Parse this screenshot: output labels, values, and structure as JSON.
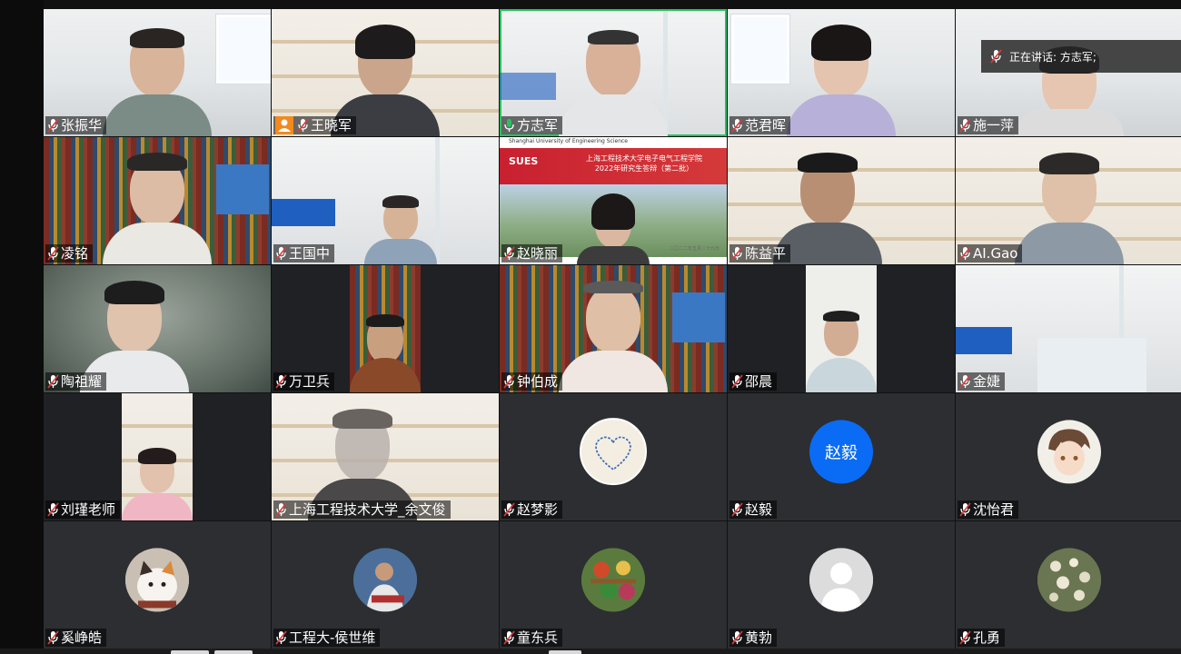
{
  "speaking_indicator": {
    "text": "正在讲话: 方志军;"
  },
  "slide": {
    "university_en": "Shanghai University of Engineering Science",
    "logo": "SUES",
    "title_line1": "上海工程技术大学电子电气工程学院",
    "title_line2": "2022年研究生答辩（第二批）",
    "date": "二〇二二年五月二十九日"
  },
  "participants": [
    {
      "name": "张振华",
      "mic": "on"
    },
    {
      "name": "王晓军",
      "mic": "on",
      "host": true
    },
    {
      "name": "方志军",
      "mic": "speaking",
      "active": true
    },
    {
      "name": "范君晖",
      "mic": "on"
    },
    {
      "name": "施一萍",
      "mic": "on"
    },
    {
      "name": "凌铭",
      "mic": "on"
    },
    {
      "name": "王国中",
      "mic": "on"
    },
    {
      "name": "赵晓丽",
      "mic": "on"
    },
    {
      "name": "陈益平",
      "mic": "on"
    },
    {
      "name": "AI.Gao",
      "mic": "on"
    },
    {
      "name": "陶祖耀",
      "mic": "on"
    },
    {
      "name": "万卫兵",
      "mic": "on"
    },
    {
      "name": "钟伯成",
      "mic": "on"
    },
    {
      "name": "邵晨",
      "mic": "on"
    },
    {
      "name": "金婕",
      "mic": "on"
    },
    {
      "name": "刘瑾老师",
      "mic": "on"
    },
    {
      "name": "上海工程技术大学_余文俊",
      "mic": "on"
    },
    {
      "name": "赵梦影",
      "mic": "on"
    },
    {
      "name": "赵毅",
      "mic": "on",
      "avatar_text": "赵毅"
    },
    {
      "name": "沈怡君",
      "mic": "on"
    },
    {
      "name": "奚峥皓",
      "mic": "on"
    },
    {
      "name": "工程大-侯世维",
      "mic": "on"
    },
    {
      "name": "童东兵",
      "mic": "on"
    },
    {
      "name": "黄勃",
      "mic": "on"
    },
    {
      "name": "孔勇",
      "mic": "on"
    }
  ],
  "colors": {
    "active_border": "#27c25f",
    "avatar_blue": "#0a6cf5",
    "muted_red": "#e03a3a",
    "host_orange": "#f28a1e"
  }
}
